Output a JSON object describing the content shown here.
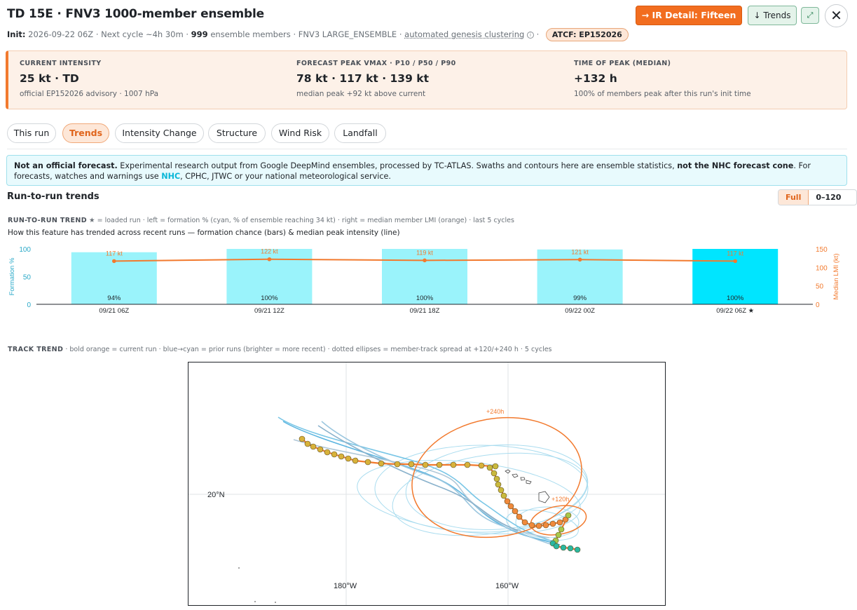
{
  "header": {
    "title": "TD 15E · FNV3 1000-member ensemble",
    "init_label": "Init:",
    "init_value": "2026-09-22 06Z",
    "next_cycle": "· Next cycle ~4h 30m ·",
    "members_count": "999",
    "members_label": "ensemble members",
    "product": "· FNV3 LARGE_ENSEMBLE ·",
    "clustering": "automated genesis clustering",
    "atcf": "ATCF: EP152026",
    "ir_button": "→ IR Detail: Fifteen",
    "trends_button": "↓ Trends",
    "expand_icon": "expand-icon",
    "close_icon": "close-icon"
  },
  "summary": [
    {
      "label": "Current intensity",
      "value": "25 kt · TD",
      "note": "official EP152026 advisory · 1007 hPa"
    },
    {
      "label": "Forecast peak Vmax · P10 / P50 / P90",
      "value": "78 kt · 117 kt · 139 kt",
      "note": "median peak +92 kt above current"
    },
    {
      "label": "Time of peak (median)",
      "value": "+132 h",
      "note": "100% of members peak after this run's init time"
    }
  ],
  "tabs": [
    "This run",
    "Trends",
    "Intensity Change",
    "Structure",
    "Wind Risk",
    "Landfall"
  ],
  "active_tab": "Trends",
  "notice": {
    "lead": "Not an official forecast.",
    "text1": " Experimental research output from Google DeepMind ensembles, processed by TC-ATLAS. Swaths and contours here are ensemble statistics, ",
    "strong": "not the NHC forecast cone",
    "text2": ". For forecasts, watches and warnings use ",
    "link": "NHC",
    "text3": ", CPHC, JTWC or your national meteorological service."
  },
  "section": {
    "title": "Run-to-run trends",
    "toggle_full": "Full",
    "toggle_short": "0–120 h"
  },
  "trend": {
    "head_label": "RUN-TO-RUN TREND",
    "head_text": "★ = loaded run · left = formation % (cyan, % of ensemble reaching 34 kt) · right = median member LMI (orange) · last 5 cycles",
    "desc": "How this feature has trended across recent runs — formation chance (bars) & median peak intensity (line)"
  },
  "chart_data": {
    "type": "bar",
    "categories": [
      "09/21 06Z",
      "09/21 12Z",
      "09/21 18Z",
      "09/22 00Z",
      "09/22 06Z ★"
    ],
    "series": [
      {
        "values": [
          94,
          100,
          100,
          99,
          100
        ],
        "value_labels": [
          "94%",
          "100%",
          "100%",
          "99%",
          "100%"
        ],
        "axis": "left",
        "color": "#9af3fb",
        "highlight_color": "#00e5ff"
      },
      {
        "values": [
          117,
          122,
          119,
          121,
          117
        ],
        "value_labels": [
          "117 kt",
          "122 kt",
          "119 kt",
          "121 kt",
          "117 kt"
        ],
        "axis": "right",
        "type": "line",
        "color": "#f27a2e"
      }
    ],
    "ylabel": "Formation %",
    "ylabel_right": "Median LMI (kt)",
    "ylim": [
      0,
      100
    ],
    "ylim_right": [
      0,
      150
    ],
    "yticks": [
      0,
      50,
      100
    ],
    "yticks_right": [
      0,
      50,
      100,
      150
    ],
    "highlight_index": 4
  },
  "track": {
    "head_label": "TRACK TREND",
    "head_text": "· bold orange = current run · blue→cyan = prior runs (brighter = more recent) · dotted ellipses = member-track spread at +120/+240 h · 5 cycles",
    "lat_label": "20°N",
    "lon_labels": [
      "180°W",
      "160°W"
    ],
    "lead_labels": [
      "+240h",
      "+120h"
    ],
    "colors": {
      "current": "#f27a2e",
      "prior": "#5bc0e8"
    }
  }
}
